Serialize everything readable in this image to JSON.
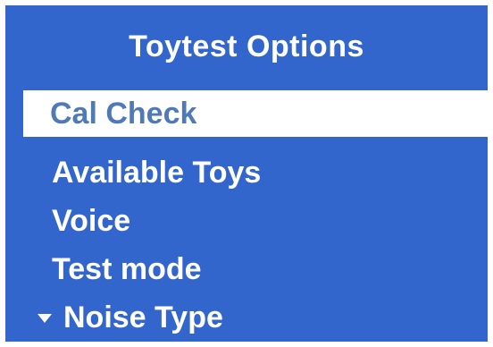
{
  "screen": {
    "title": "Toytest Options",
    "background_color": "#3366cc",
    "highlight_color": "#ffffff",
    "highlight_text_color": "#4f7ab5"
  },
  "menu": {
    "items": [
      {
        "label": "Cal Check",
        "selected": true
      },
      {
        "label": "Available Toys",
        "selected": false
      },
      {
        "label": "Voice",
        "selected": false
      },
      {
        "label": "Test mode",
        "selected": false
      },
      {
        "label": "Noise Type",
        "selected": false,
        "icon": "down-arrow-icon"
      }
    ]
  }
}
